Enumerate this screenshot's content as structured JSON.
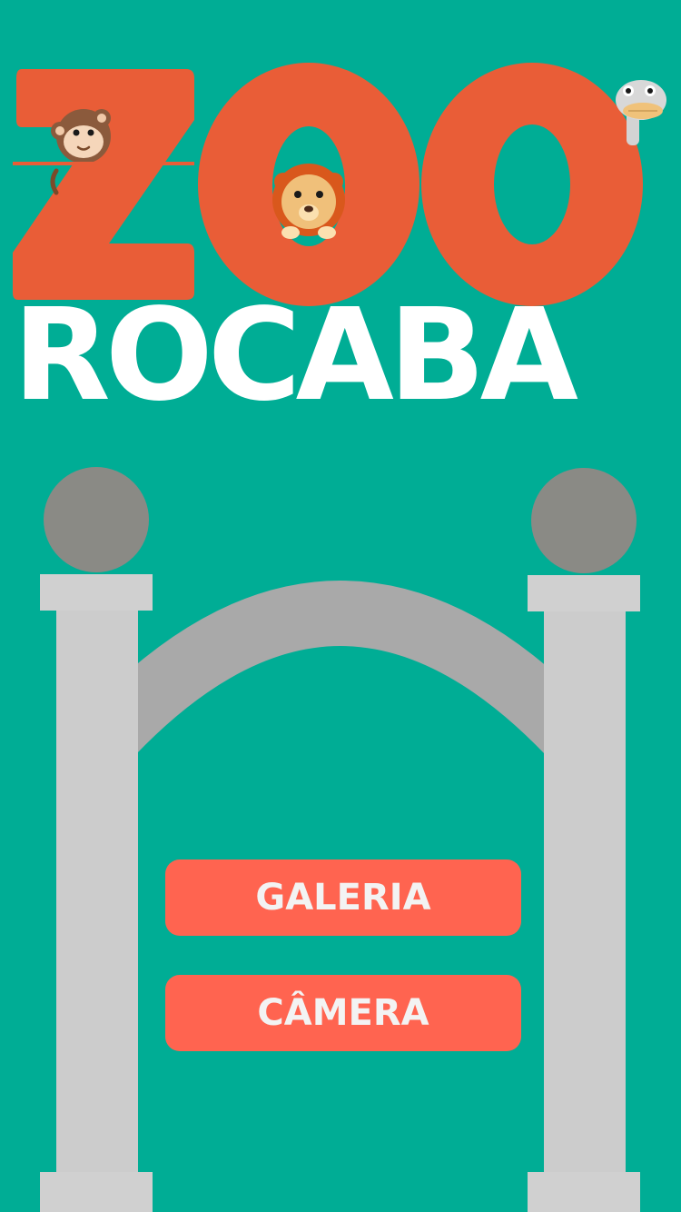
{
  "logo": {
    "line1": "ZOO",
    "line2": "ROCABA",
    "mascots": [
      "monkey-icon",
      "lion-icon",
      "ostrich-icon"
    ]
  },
  "menu": {
    "gallery_label": "GALERIA",
    "camera_label": "CÂMERA"
  },
  "colors": {
    "background": "#00AD95",
    "logo_orange": "#E95D37",
    "button": "#FF6450",
    "button_text": "#F3F3F3",
    "pillar": "#CCCCCC",
    "arch": "#A9A9A9",
    "orb": "#8A8A85"
  }
}
